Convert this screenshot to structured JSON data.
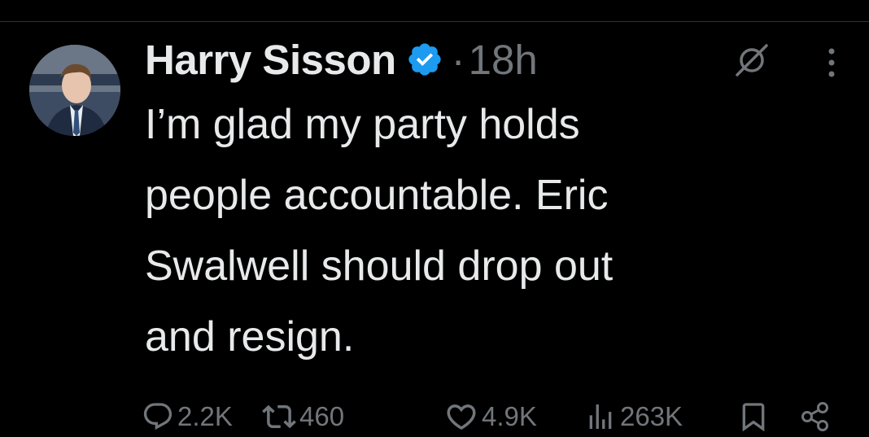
{
  "post": {
    "author": {
      "display_name": "Harry Sisson",
      "verified": true
    },
    "separator": "·",
    "timestamp": "18h",
    "text": "I’m glad my party holds\npeople accountable. Eric\nSwalwell should drop out\nand resign."
  },
  "actions": {
    "replies": "2.2K",
    "reposts": "460",
    "likes": "4.9K",
    "views": "263K"
  },
  "icons": {
    "verified": "verified-badge-icon",
    "grok": "grok-icon",
    "more": "more-icon",
    "reply": "reply-icon",
    "repost": "repost-icon",
    "like": "like-icon",
    "views": "views-icon",
    "bookmark": "bookmark-icon",
    "share": "share-icon"
  },
  "colors": {
    "background": "#000000",
    "text": "#e7e9ea",
    "muted": "#71767b",
    "verified": "#1d9bf0"
  }
}
